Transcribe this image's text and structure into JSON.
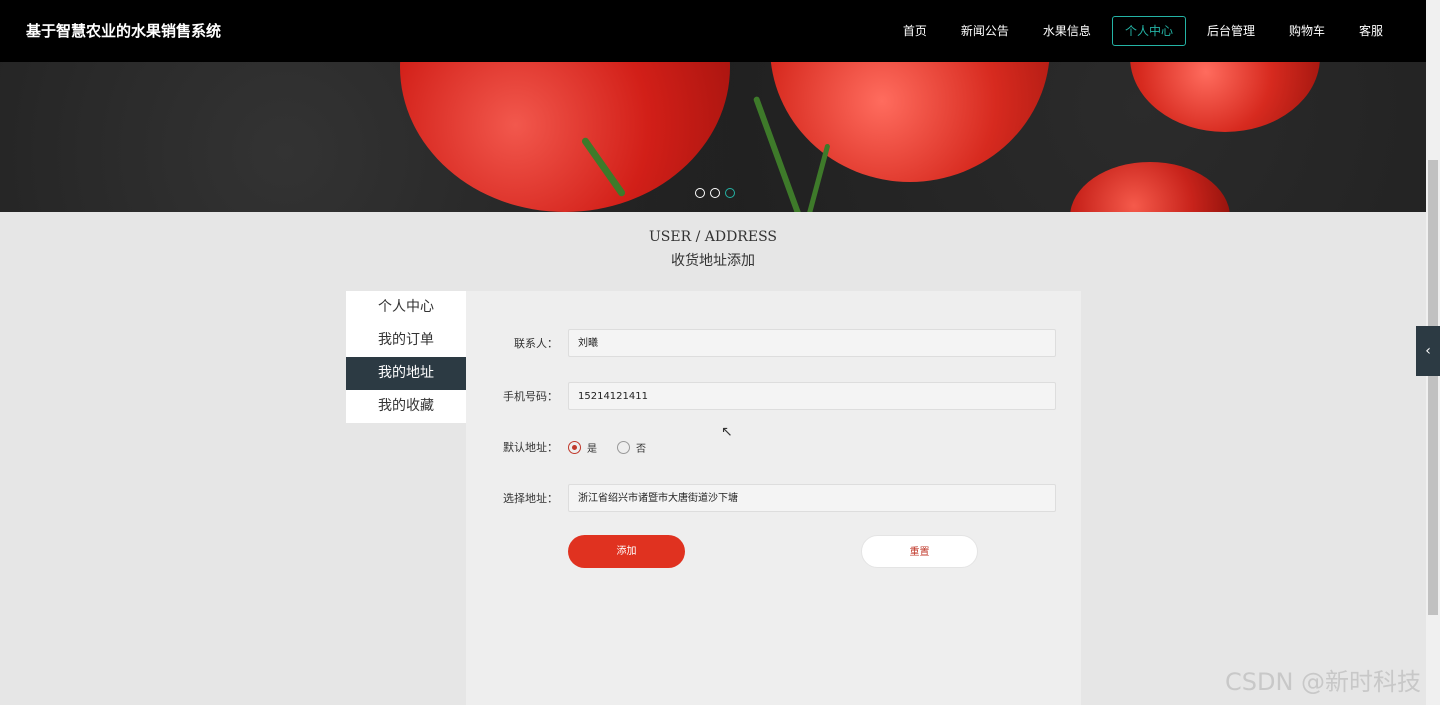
{
  "header": {
    "brand": "基于智慧农业的水果销售系统",
    "nav": [
      {
        "label": "首页"
      },
      {
        "label": "新闻公告"
      },
      {
        "label": "水果信息"
      },
      {
        "label": "个人中心"
      },
      {
        "label": "后台管理"
      },
      {
        "label": "购物车"
      },
      {
        "label": "客服"
      }
    ],
    "active_nav": "个人中心"
  },
  "banner": {
    "dot_count": 3,
    "active_dot": 3
  },
  "page": {
    "title_en": "USER / ADDRESS",
    "title_cn": "收货地址添加"
  },
  "sidebar": {
    "items": [
      {
        "label": "个人中心"
      },
      {
        "label": "我的订单"
      },
      {
        "label": "我的地址"
      },
      {
        "label": "我的收藏"
      }
    ],
    "active": "我的地址"
  },
  "form": {
    "contact": {
      "label": "联系人：",
      "value": "刘曦"
    },
    "phone": {
      "label": "手机号码：",
      "value": "15214121411"
    },
    "default": {
      "label": "默认地址：",
      "options": [
        "是",
        "否"
      ],
      "selected": "是"
    },
    "address": {
      "label": "选择地址：",
      "value": "浙江省绍兴市诸暨市大唐街道沙下塘"
    },
    "add_button": "添加",
    "reset_button": "重置"
  },
  "watermark": "CSDN @新时科技",
  "colors": {
    "accent": "#24b3a5",
    "primary_button": "#e03220",
    "sidebar_active": "#2c3a43"
  }
}
